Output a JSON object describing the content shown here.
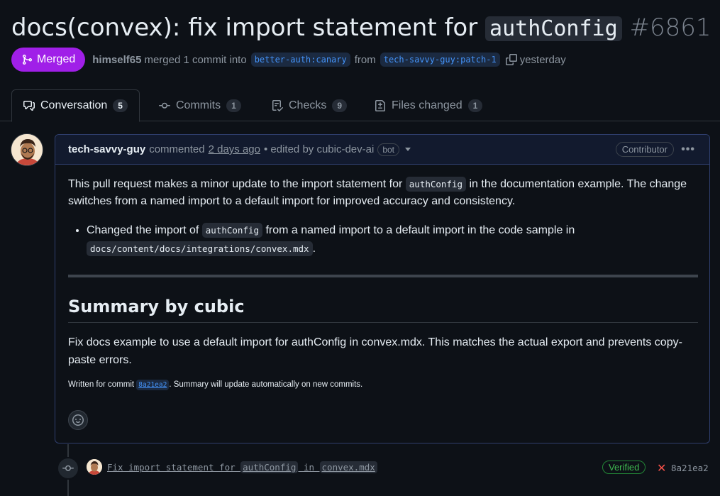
{
  "pr": {
    "title_prefix": "docs(convex): fix import statement for ",
    "title_code": "authConfig",
    "number": "#6861",
    "state": "Merged",
    "merged_by": "himself65",
    "merged_text": "merged 1 commit into",
    "base_branch": "better-auth:canary",
    "from_text": "from",
    "head_branch": "tech-savvy-guy:patch-1",
    "when": "yesterday"
  },
  "tabs": [
    {
      "label": "Conversation",
      "count": "5",
      "icon": "comment-discussion-icon",
      "active": true
    },
    {
      "label": "Commits",
      "count": "1",
      "icon": "git-commit-icon"
    },
    {
      "label": "Checks",
      "count": "9",
      "icon": "checklist-icon"
    },
    {
      "label": "Files changed",
      "count": "1",
      "icon": "file-diff-icon"
    }
  ],
  "comment": {
    "author": "tech-savvy-guy",
    "action": "commented",
    "time": "2 days ago",
    "edited": "• edited by cubic-dev-ai",
    "bot_badge": "bot",
    "role_badge": "Contributor",
    "para1_a": "This pull request makes a minor update to the import statement for ",
    "para1_code": "authConfig",
    "para1_b": " in the documentation example. The change switches from a named import to a default import for improved accuracy and consistency.",
    "bullet_a": "Changed the import of ",
    "bullet_code1": "authConfig",
    "bullet_b": " from a named import to a default import in the code sample in ",
    "bullet_code2": "docs/content/docs/integrations/convex.mdx",
    "bullet_c": ".",
    "summary_heading": "Summary by cubic",
    "summary_text": "Fix docs example to use a default import for authConfig in convex.mdx. This matches the actual export and prevents copy-paste errors.",
    "written_a": "Written for commit ",
    "written_hash": "8a21ea2",
    "written_b": ". Summary will update automatically on new commits."
  },
  "commit": {
    "msg_a": "Fix import statement for ",
    "msg_code1": "authConfig",
    "msg_b": " in ",
    "msg_code2": "convex.mdx",
    "verified": "Verified",
    "sha": "8a21ea2"
  },
  "colors": {
    "merged": "#a01fe8",
    "link": "#4493f8",
    "verified": "#3fb950",
    "fail": "#f85149"
  }
}
